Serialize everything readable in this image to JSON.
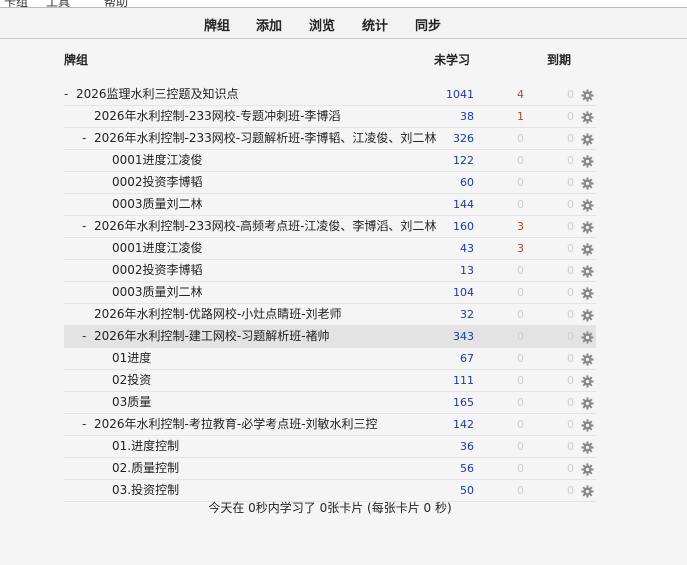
{
  "menu": [
    "卡组",
    "工具",
    "帮助"
  ],
  "toolbar": {
    "decks": "牌组",
    "add": "添加",
    "browse": "浏览",
    "stats": "统计",
    "sync": "同步"
  },
  "header": {
    "deck": "牌组",
    "new": "未学习",
    "due": "到期"
  },
  "decks": [
    {
      "indent": 0,
      "collapse": "-",
      "name": "2026监理水利三控题及知识点",
      "new": "1041",
      "learn": "4",
      "due": "0"
    },
    {
      "indent": 1,
      "collapse": "",
      "name": "2026年水利控制-233网校-专题冲刺班-李博滔",
      "new": "38",
      "learn": "1",
      "due": "0"
    },
    {
      "indent": 1,
      "collapse": "-",
      "name": "2026年水利控制-233网校-习题解析班-李博韬、江凌俊、刘二林",
      "new": "326",
      "learn": "0",
      "due": "0"
    },
    {
      "indent": 2,
      "collapse": "",
      "name": "0001进度江凌俊",
      "new": "122",
      "learn": "0",
      "due": "0"
    },
    {
      "indent": 2,
      "collapse": "",
      "name": "0002投资李博韬",
      "new": "60",
      "learn": "0",
      "due": "0"
    },
    {
      "indent": 2,
      "collapse": "",
      "name": "0003质量刘二林",
      "new": "144",
      "learn": "0",
      "due": "0"
    },
    {
      "indent": 1,
      "collapse": "-",
      "name": "2026年水利控制-233网校-高频考点班-江凌俊、李博滔、刘二林",
      "new": "160",
      "learn": "3",
      "due": "0"
    },
    {
      "indent": 2,
      "collapse": "",
      "name": "0001进度江凌俊",
      "new": "43",
      "learn": "3",
      "due": "0"
    },
    {
      "indent": 2,
      "collapse": "",
      "name": "0002投资李博韬",
      "new": "13",
      "learn": "0",
      "due": "0"
    },
    {
      "indent": 2,
      "collapse": "",
      "name": "0003质量刘二林",
      "new": "104",
      "learn": "0",
      "due": "0"
    },
    {
      "indent": 1,
      "collapse": "",
      "name": "2026年水利控制-优路网校-小灶点睛班-刘老师",
      "new": "32",
      "learn": "0",
      "due": "0"
    },
    {
      "indent": 1,
      "collapse": "-",
      "name": "2026年水利控制-建工网校-习题解析班-褚帅",
      "new": "343",
      "learn": "0",
      "due": "0",
      "selected": true
    },
    {
      "indent": 2,
      "collapse": "",
      "name": "01进度",
      "new": "67",
      "learn": "0",
      "due": "0"
    },
    {
      "indent": 2,
      "collapse": "",
      "name": "02投资",
      "new": "111",
      "learn": "0",
      "due": "0"
    },
    {
      "indent": 2,
      "collapse": "",
      "name": "03质量",
      "new": "165",
      "learn": "0",
      "due": "0"
    },
    {
      "indent": 1,
      "collapse": "-",
      "name": "2026年水利控制-考拉教育-必学考点班-刘敏水利三控",
      "new": "142",
      "learn": "0",
      "due": "0"
    },
    {
      "indent": 2,
      "collapse": "",
      "name": "01.进度控制",
      "new": "36",
      "learn": "0",
      "due": "0"
    },
    {
      "indent": 2,
      "collapse": "",
      "name": "02.质量控制",
      "new": "56",
      "learn": "0",
      "due": "0"
    },
    {
      "indent": 2,
      "collapse": "",
      "name": "03.投资控制",
      "new": "50",
      "learn": "0",
      "due": "0"
    }
  ],
  "footer": "今天在 0秒内学习了 0张卡片 (每张卡片 0 秒)",
  "colors": {
    "new": "#1a3aa0",
    "learn": "#c0431a",
    "zero": "#cfcfcf"
  },
  "icons": {
    "options": "gear-icon"
  }
}
